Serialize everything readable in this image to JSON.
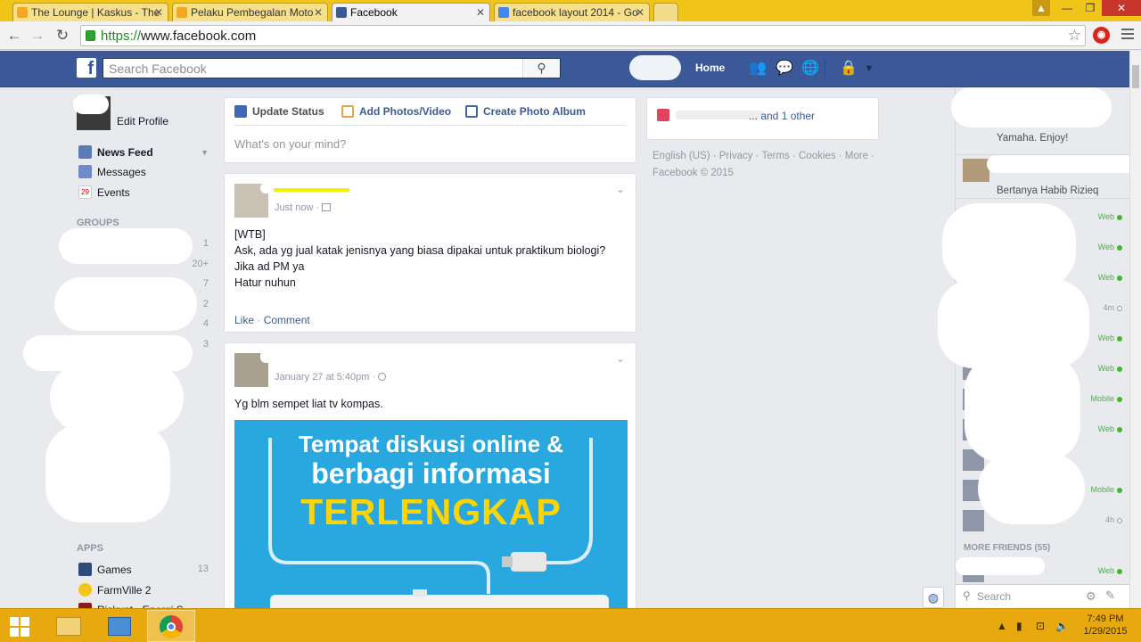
{
  "browser": {
    "tabs": [
      {
        "title": "The Lounge | Kaskus - The",
        "favicon_color": "#f5a623"
      },
      {
        "title": "Pelaku Pembegalan Moto",
        "favicon_color": "#f5a623"
      },
      {
        "title": "Facebook",
        "favicon_color": "#3b5998"
      },
      {
        "title": "facebook layout 2014 - Go",
        "favicon_color": "#4285f4"
      }
    ],
    "url_scheme": "https://",
    "url_host": "www.facebook.com",
    "accent": "#f0c419"
  },
  "fb": {
    "logo": "f",
    "search_placeholder": "Search Facebook",
    "home_label": "Home",
    "brand_color": "#3b5998",
    "jewels": [
      "friends-icon",
      "messages-icon",
      "notifications-icon",
      "privacy-icon",
      "account-menu-icon"
    ]
  },
  "left_nav": {
    "edit_profile": "Edit Profile",
    "items": [
      {
        "label": "News Feed",
        "icon": "news-feed-icon"
      },
      {
        "label": "Messages",
        "icon": "messages-icon"
      },
      {
        "label": "Events",
        "icon": "events-icon",
        "badge": "29"
      }
    ],
    "groups_heading": "GROUPS",
    "group_counts": [
      "1",
      "20+",
      "7",
      "2",
      "4",
      "3"
    ],
    "apps_heading": "APPS",
    "apps": [
      {
        "label": "Games",
        "count": "13"
      },
      {
        "label": "FarmVille 2",
        "count": ""
      },
      {
        "label": "Riskuat - Energi S",
        "count": ""
      }
    ]
  },
  "composer": {
    "tabs": [
      "Update Status",
      "Add Photos/Video",
      "Create Photo Album"
    ],
    "placeholder": "What's on your mind?"
  },
  "posts": [
    {
      "time": "Just now · ",
      "text": "[WTB]\nAsk, ada yg jual katak jenisnya yang biasa dipakai untuk praktikum biologi?\nJika ad PM ya\nHatur nuhun",
      "like": "Like",
      "comment": "Comment"
    },
    {
      "time": "January 27 at 5:40pm · ",
      "text": "Yg blm sempet liat tv kompas.",
      "image_line1": "Tempat diskusi online &",
      "image_line2": "berbagi informasi",
      "image_line3": "TERLENGKAP"
    }
  ],
  "right": {
    "birthday_text": "... and 1 other",
    "footer_links": "English (US) · Privacy · Terms · Cookies · More ·",
    "copyright": "Facebook © 2015"
  },
  "chat": {
    "ticker_1": "Yamaha. Enjoy!",
    "ticker_2": "Bertanya Habib Rizieq",
    "friends": [
      {
        "status": "Web",
        "state": "online"
      },
      {
        "status": "Web",
        "state": "online"
      },
      {
        "status": "Web",
        "state": "online"
      },
      {
        "status": "4m",
        "state": "idle"
      },
      {
        "status": "Web",
        "state": "online"
      },
      {
        "status": "Web",
        "state": "online"
      },
      {
        "status": "Mobile",
        "state": "online"
      },
      {
        "status": "Web",
        "state": "online"
      },
      {
        "status": "",
        "state": "none"
      },
      {
        "status": "Mobile",
        "state": "online"
      },
      {
        "status": "4h",
        "state": "idle"
      }
    ],
    "more_friends": "MORE FRIENDS (55)",
    "more_friend_status": "Web",
    "search_placeholder": "Search"
  },
  "taskbar": {
    "time": "7:49 PM",
    "date": "1/29/2015",
    "color": "#e8a90e"
  }
}
